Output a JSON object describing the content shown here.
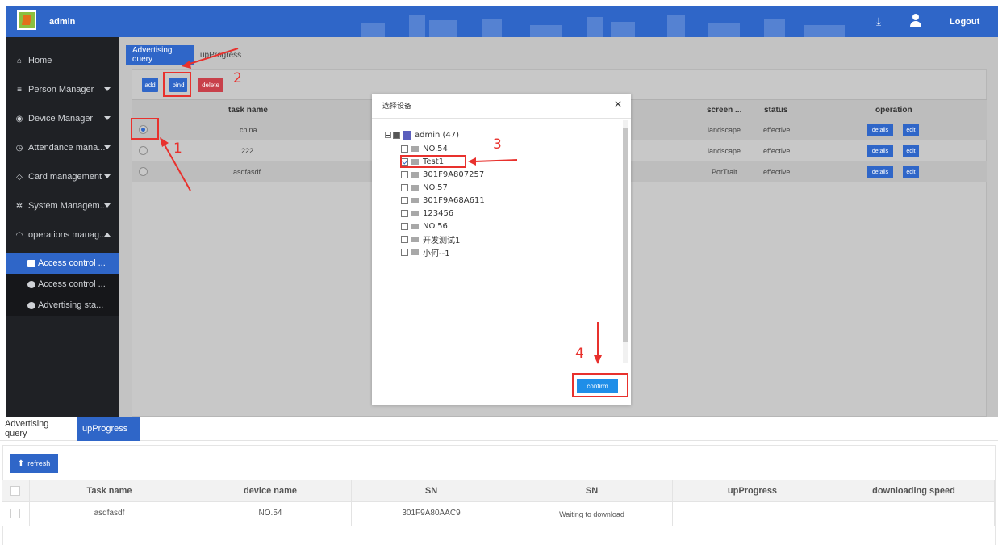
{
  "header": {
    "app_title": "admin",
    "download_icon": "download-icon",
    "user_icon": "user-icon",
    "logout_label": "Logout"
  },
  "sidebar": {
    "items": [
      {
        "label": "Home",
        "icon": "home-icon"
      },
      {
        "label": "Person Manager",
        "icon": "list-icon"
      },
      {
        "label": "Device Manager",
        "icon": "device-icon"
      },
      {
        "label": "Attendance mana...",
        "icon": "clock-icon"
      },
      {
        "label": "Card management",
        "icon": "tag-icon"
      },
      {
        "label": "System Managem...",
        "icon": "gear-icon"
      },
      {
        "label": "operations manag...",
        "icon": "gauge-icon"
      }
    ],
    "sub_items": [
      {
        "label": "Access control ...",
        "icon": "monitor-icon",
        "active": true
      },
      {
        "label": "Access control ...",
        "icon": "circle-icon",
        "active": false
      },
      {
        "label": "Advertising sta...",
        "icon": "circle-icon",
        "active": false
      }
    ]
  },
  "main": {
    "tabs": [
      {
        "label": "Advertising query",
        "active": true
      },
      {
        "label": "upProgress",
        "active": false
      }
    ],
    "toolbar": {
      "add_label": "add",
      "bind_label": "bind",
      "delete_label": "delete"
    },
    "table": {
      "headers": [
        "task name",
        "screen ...",
        "status",
        "operation"
      ],
      "rows": [
        {
          "task_name": "china",
          "screen": "landscape",
          "status": "effective",
          "selected": true
        },
        {
          "task_name": "222",
          "screen": "landscape",
          "status": "effective",
          "selected": false
        },
        {
          "task_name": "asdfasdf",
          "screen": "PorTrait",
          "status": "effective",
          "selected": false
        }
      ],
      "details_label": "details",
      "edit_label": "edit"
    }
  },
  "modal": {
    "title": "选择设备",
    "close_icon": "close-icon",
    "root_node": "admin (47)",
    "devices": [
      {
        "label": "NO.54",
        "checked": false
      },
      {
        "label": "Test1",
        "checked": true
      },
      {
        "label": "301F9A807257",
        "checked": false
      },
      {
        "label": "NO.57",
        "checked": false
      },
      {
        "label": "301F9A68A611",
        "checked": false
      },
      {
        "label": "123456",
        "checked": false
      },
      {
        "label": "NO.56",
        "checked": false
      },
      {
        "label": "开发测试1",
        "checked": false
      },
      {
        "label": "小何--1",
        "checked": false
      }
    ],
    "confirm_label": "confirm"
  },
  "annotations": {
    "step1": "1",
    "step2": "2",
    "step3": "3",
    "step4": "4",
    "color": "#e8312d"
  },
  "bottom": {
    "tabs": [
      {
        "label": "Advertising query",
        "active": false
      },
      {
        "label": "upProgress",
        "active": true
      }
    ],
    "refresh_label": "refresh",
    "table": {
      "headers": [
        "Task name",
        "device name",
        "SN",
        "SN",
        "upProgress",
        "downloading speed"
      ],
      "rows": [
        {
          "task_name": "asdfasdf",
          "device_name": "NO.54",
          "sn": "301F9A80AAC9",
          "sn2": "Waiting to download",
          "up_progress": "",
          "speed": ""
        }
      ]
    }
  },
  "colors": {
    "accent": "#2f66c8",
    "sidebar_bg": "#1f2125",
    "danger": "#c8404a",
    "confirm": "#1f8ee8"
  }
}
